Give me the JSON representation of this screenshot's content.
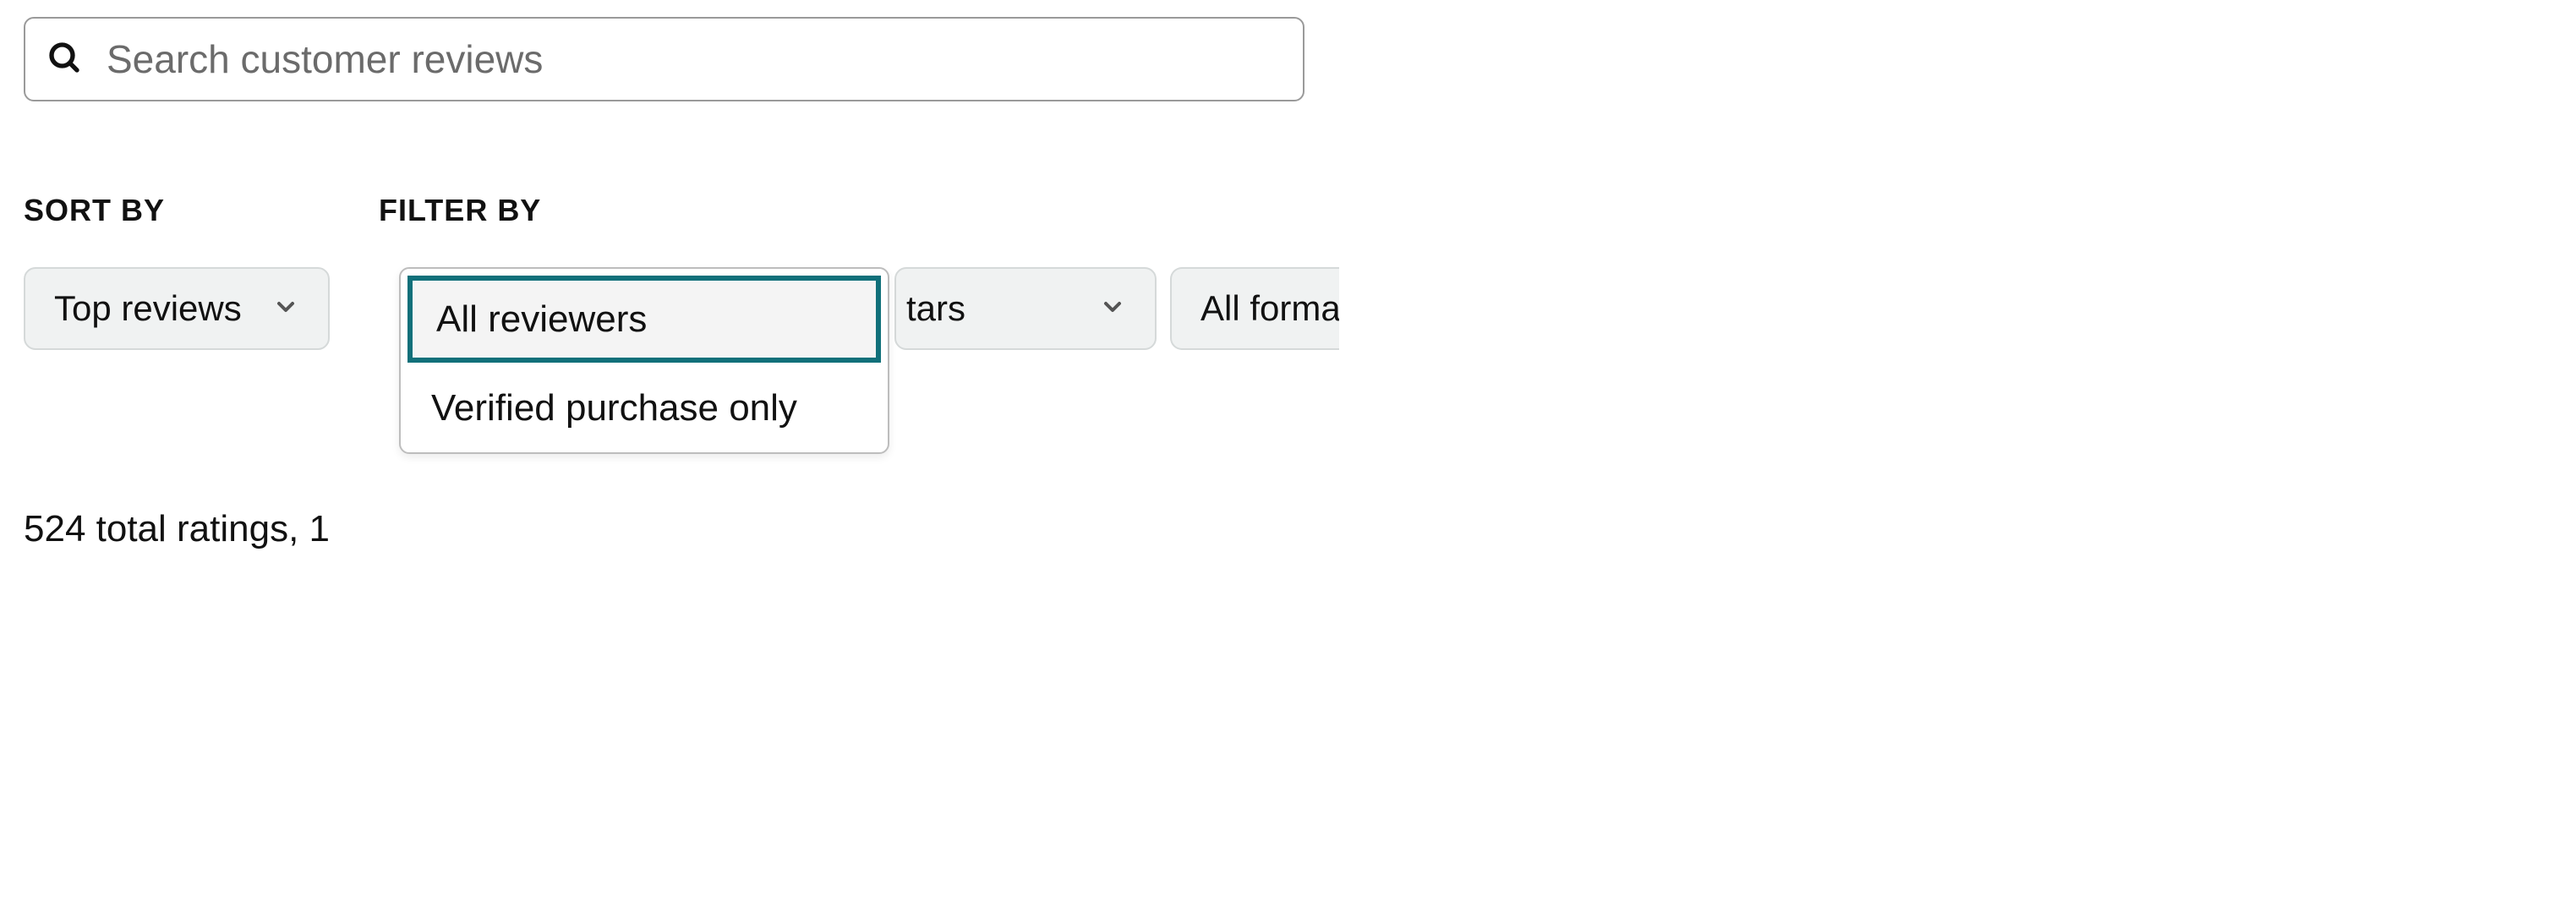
{
  "search": {
    "placeholder": "Search customer reviews"
  },
  "labels": {
    "sort": "SORT BY",
    "filter": "FILTER BY"
  },
  "sort": {
    "selected": "Top reviews"
  },
  "filter": {
    "reviewers": {
      "options": [
        "All reviewers",
        "Verified purchase only"
      ],
      "selected": "All reviewers"
    },
    "stars_fragment": "tars",
    "formats_fragment": "All forma"
  },
  "summary_fragment": "524 total ratings, 1"
}
